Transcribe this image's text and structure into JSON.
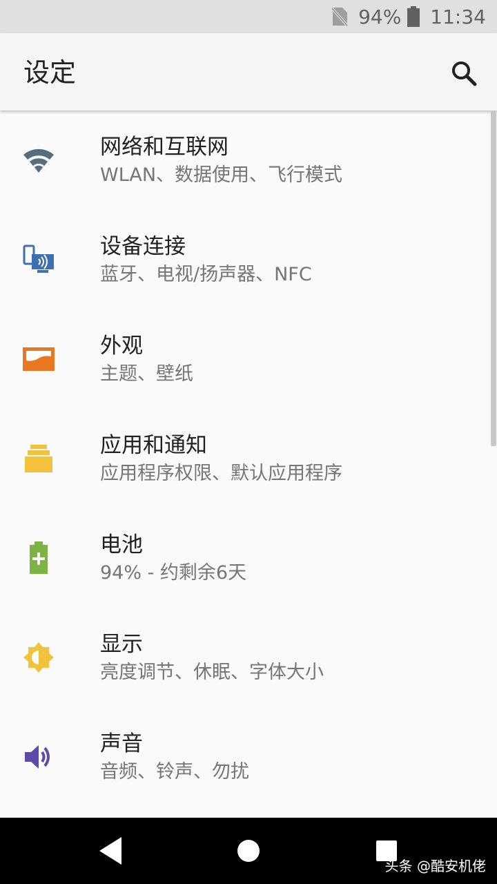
{
  "status_bar": {
    "battery_percent": "94%",
    "battery_level": 0.94,
    "time": "11:34",
    "icons": [
      "no-sim-icon",
      "battery-icon"
    ]
  },
  "app_bar": {
    "title": "设定",
    "search_icon": "search-icon"
  },
  "settings": [
    {
      "title": "网络和互联网",
      "summary": "WLAN、数据使用、飞行模式",
      "icon": "wifi-icon",
      "color": "#546e7a"
    },
    {
      "title": "设备连接",
      "summary": "蓝牙、电视/扬声器、NFC",
      "icon": "devices-icon",
      "color": "#3f6fb3"
    },
    {
      "title": "外观",
      "summary": "主题、壁纸",
      "icon": "appearance-icon",
      "color": "#e87722"
    },
    {
      "title": "应用和通知",
      "summary": "应用程序权限、默认应用程序",
      "icon": "apps-icon",
      "color": "#f2c23d"
    },
    {
      "title": "电池",
      "summary": "94% - 约剩余6天",
      "icon": "battery-plus-icon",
      "color": "#7cb342"
    },
    {
      "title": "显示",
      "summary": "亮度调节、休眠、字体大小",
      "icon": "brightness-icon",
      "color": "#f2c23d"
    },
    {
      "title": "声音",
      "summary": "音频、铃声、勿扰",
      "icon": "volume-icon",
      "color": "#5e4aa8"
    }
  ],
  "nav_bar": {
    "back_icon": "back-icon",
    "home_icon": "home-icon",
    "recents_icon": "recents-icon"
  },
  "watermark": "头条 @酷安机佬"
}
